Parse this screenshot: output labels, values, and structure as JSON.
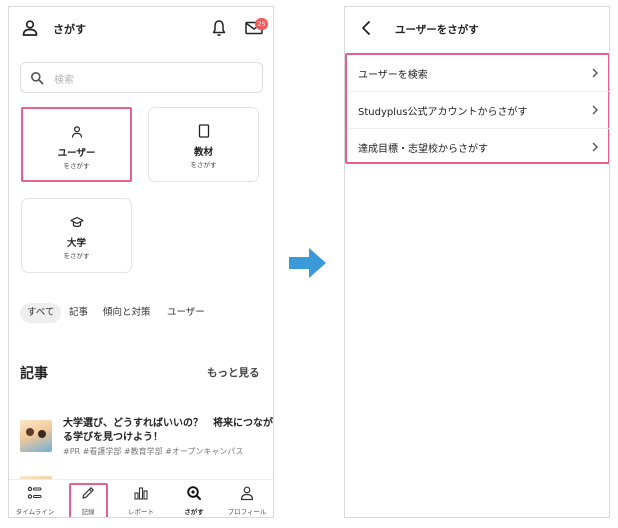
{
  "left_screen": {
    "header": {
      "title": "さがす",
      "badge_count": "25"
    },
    "search": {
      "placeholder": "検索"
    },
    "categories": [
      {
        "label": "ユーザー",
        "sub": "をさがす",
        "icon": "user-icon"
      },
      {
        "label": "教材",
        "sub": "をさがす",
        "icon": "book-icon"
      },
      {
        "label": "大学",
        "sub": "をさがす",
        "icon": "graduation-cap-icon"
      }
    ],
    "filter_chips": [
      "すべて",
      "記事",
      "傾向と対策",
      "ユーザー"
    ],
    "articles_section": {
      "title": "記事",
      "more": "もっと見る"
    },
    "articles": [
      {
        "title": "大学選び、どうすればいいの？　将来につながる学びを見つけよう！",
        "tags": "#PR #看護学部 #教育学部 #オープンキャンパス"
      }
    ],
    "tabbar": [
      {
        "label": "タイムライン",
        "icon": "timeline-icon"
      },
      {
        "label": "記録",
        "icon": "pencil-icon"
      },
      {
        "label": "レポート",
        "icon": "bar-chart-icon"
      },
      {
        "label": "さがす",
        "icon": "search-icon",
        "active": true
      },
      {
        "label": "プロフィール",
        "icon": "profile-icon"
      }
    ]
  },
  "right_screen": {
    "header": {
      "title": "ユーザーをさがす"
    },
    "menu_items": [
      "ユーザーを検索",
      "Studyplus公式アカウントからさがす",
      "達成目標・志望校からさがす"
    ]
  },
  "colors": {
    "highlight": "#e85f92",
    "arrow": "#3a9ad9",
    "badge": "#f05a5a"
  }
}
